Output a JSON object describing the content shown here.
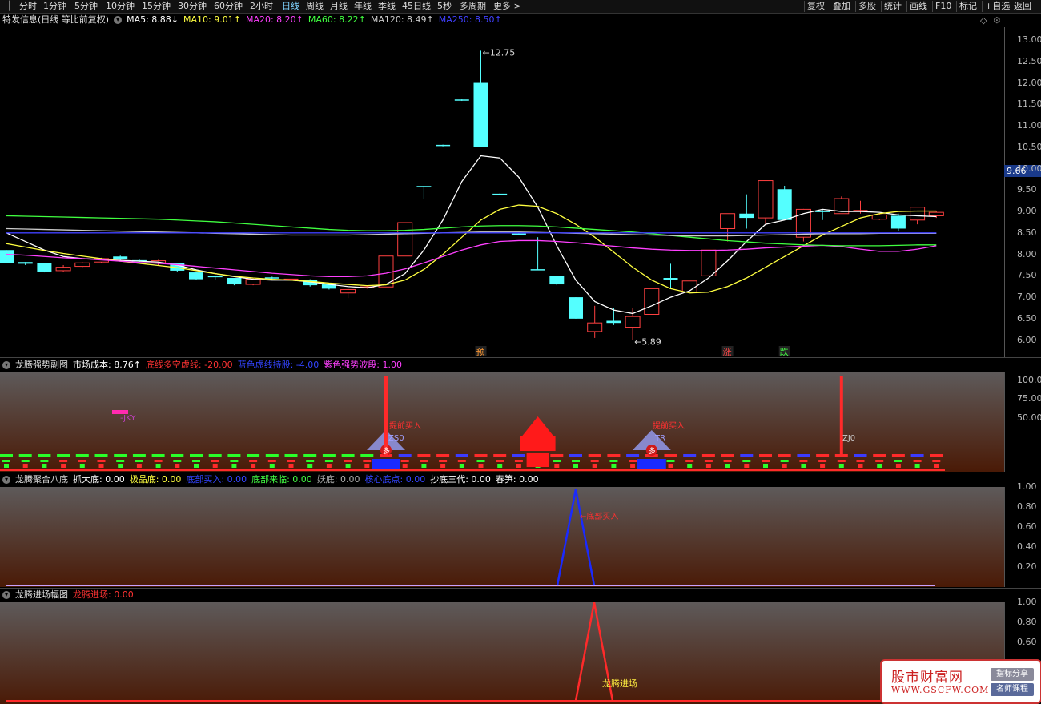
{
  "toolbar": {
    "periods": [
      "分时",
      "1分钟",
      "5分钟",
      "10分钟",
      "15分钟",
      "30分钟",
      "60分钟",
      "2小时",
      "日线",
      "周线",
      "月线",
      "年线",
      "季线",
      "45日线",
      "5秒",
      "多周期",
      "更多 >"
    ],
    "active_period": "日线",
    "right_buttons": [
      "复权",
      "叠加",
      "多股",
      "统计",
      "画线",
      "F10",
      "标记",
      "+自选",
      "返回"
    ]
  },
  "main": {
    "title": "特发信息(日线 等比前复权)",
    "indicators": [
      {
        "label": "MA5: 8.88↓",
        "color": "#ffffff"
      },
      {
        "label": "MA10: 9.01↑",
        "color": "#ffff40"
      },
      {
        "label": "MA20: 8.20↑",
        "color": "#ff40ff"
      },
      {
        "label": "MA60: 8.22↑",
        "color": "#40ff40"
      },
      {
        "label": "MA120: 8.49↑",
        "color": "#cccccc"
      },
      {
        "label": "MA250: 8.50↑",
        "color": "#4040ff"
      }
    ],
    "price_ticks": [
      "13.00",
      "12.50",
      "12.00",
      "11.50",
      "11.00",
      "10.50",
      "10.00",
      "9.50",
      "9.00",
      "8.50",
      "8.00",
      "7.50",
      "7.00",
      "6.50",
      "6.00"
    ],
    "current_price": "9.66",
    "high_label": "12.75",
    "low_label": "5.89",
    "markers": [
      {
        "text": "预",
        "color": "#ff9933"
      },
      {
        "text": "涨",
        "color": "#ff4444"
      },
      {
        "text": "跌",
        "color": "#44ff44"
      }
    ]
  },
  "chart_data": {
    "type": "candlestick",
    "candles": [
      {
        "o": 8.1,
        "c": 7.8,
        "h": 8.1,
        "l": 7.8
      },
      {
        "o": 7.82,
        "c": 7.78,
        "h": 7.82,
        "l": 7.75
      },
      {
        "o": 7.8,
        "c": 7.6,
        "h": 7.8,
        "l": 7.58
      },
      {
        "o": 7.62,
        "c": 7.7,
        "h": 7.75,
        "l": 7.6
      },
      {
        "o": 7.72,
        "c": 7.8,
        "h": 7.82,
        "l": 7.7
      },
      {
        "o": 7.82,
        "c": 7.9,
        "h": 7.92,
        "l": 7.8
      },
      {
        "o": 7.95,
        "c": 7.88,
        "h": 7.97,
        "l": 7.85
      },
      {
        "o": 7.85,
        "c": 7.82,
        "h": 7.88,
        "l": 7.78
      },
      {
        "o": 7.8,
        "c": 7.85,
        "h": 7.87,
        "l": 7.75
      },
      {
        "o": 7.8,
        "c": 7.62,
        "h": 7.8,
        "l": 7.6
      },
      {
        "o": 7.58,
        "c": 7.42,
        "h": 7.6,
        "l": 7.4
      },
      {
        "o": 7.48,
        "c": 7.48,
        "h": 7.5,
        "l": 7.4
      },
      {
        "o": 7.45,
        "c": 7.3,
        "h": 7.45,
        "l": 7.28
      },
      {
        "o": 7.3,
        "c": 7.42,
        "h": 7.45,
        "l": 7.28
      },
      {
        "o": 7.45,
        "c": 7.45,
        "h": 7.48,
        "l": 7.42
      },
      {
        "o": 7.4,
        "c": 7.42,
        "h": 7.44,
        "l": 7.38
      },
      {
        "o": 7.4,
        "c": 7.28,
        "h": 7.42,
        "l": 7.25
      },
      {
        "o": 7.3,
        "c": 7.2,
        "h": 7.3,
        "l": 7.18
      },
      {
        "o": 7.1,
        "c": 7.18,
        "h": 7.2,
        "l": 6.98
      },
      {
        "o": 7.22,
        "c": 7.24,
        "h": 7.26,
        "l": 7.2
      },
      {
        "o": 7.24,
        "c": 7.96,
        "h": 7.96,
        "l": 7.24
      },
      {
        "o": 7.96,
        "c": 8.74,
        "h": 8.74,
        "l": 7.96
      },
      {
        "o": 9.58,
        "c": 9.58,
        "h": 9.6,
        "l": 9.3
      },
      {
        "o": 10.54,
        "c": 10.54,
        "h": 10.56,
        "l": 10.52
      },
      {
        "o": 11.6,
        "c": 11.6,
        "h": 11.62,
        "l": 11.58
      },
      {
        "o": 12.0,
        "c": 10.5,
        "h": 12.75,
        "l": 10.5
      },
      {
        "o": 9.4,
        "c": 9.4,
        "h": 9.42,
        "l": 9.38
      },
      {
        "o": 8.47,
        "c": 8.47,
        "h": 8.49,
        "l": 8.45
      },
      {
        "o": 7.64,
        "c": 7.64,
        "h": 8.4,
        "l": 7.64
      },
      {
        "o": 7.5,
        "c": 7.3,
        "h": 7.5,
        "l": 7.28
      },
      {
        "o": 7.0,
        "c": 6.5,
        "h": 7.0,
        "l": 6.5
      },
      {
        "o": 6.2,
        "c": 6.4,
        "h": 6.8,
        "l": 6.05
      },
      {
        "o": 6.45,
        "c": 6.4,
        "h": 6.75,
        "l": 6.35
      },
      {
        "o": 6.3,
        "c": 6.55,
        "h": 6.75,
        "l": 6.0
      },
      {
        "o": 6.6,
        "c": 7.2,
        "h": 7.2,
        "l": 6.6
      },
      {
        "o": 7.45,
        "c": 7.4,
        "h": 7.78,
        "l": 7.2
      },
      {
        "o": 7.12,
        "c": 7.38,
        "h": 7.38,
        "l": 7.12
      },
      {
        "o": 7.5,
        "c": 8.1,
        "h": 8.1,
        "l": 7.5
      },
      {
        "o": 8.6,
        "c": 8.95,
        "h": 8.95,
        "l": 8.3
      },
      {
        "o": 8.95,
        "c": 8.85,
        "h": 9.4,
        "l": 8.6
      },
      {
        "o": 8.85,
        "c": 9.72,
        "h": 9.72,
        "l": 8.7
      },
      {
        "o": 9.52,
        "c": 8.8,
        "h": 9.6,
        "l": 8.8
      },
      {
        "o": 8.4,
        "c": 9.05,
        "h": 9.06,
        "l": 8.3
      },
      {
        "o": 9.0,
        "c": 9.0,
        "h": 9.05,
        "l": 8.8
      },
      {
        "o": 8.95,
        "c": 9.3,
        "h": 9.35,
        "l": 8.95
      },
      {
        "o": 9.0,
        "c": 9.02,
        "h": 9.25,
        "l": 8.95
      },
      {
        "o": 8.82,
        "c": 8.92,
        "h": 8.95,
        "l": 8.8
      },
      {
        "o": 8.9,
        "c": 8.6,
        "h": 8.95,
        "l": 8.55
      },
      {
        "o": 8.8,
        "c": 9.1,
        "h": 9.1,
        "l": 8.7
      },
      {
        "o": 8.9,
        "c": 8.98,
        "h": 9.02,
        "l": 8.85
      }
    ],
    "ma": [
      {
        "name": "MA5",
        "color": "#ffffff",
        "values": [
          8.5,
          8.3,
          8.1,
          7.95,
          7.9,
          7.88,
          7.86,
          7.84,
          7.82,
          7.75,
          7.64,
          7.55,
          7.48,
          7.42,
          7.4,
          7.4,
          7.36,
          7.3,
          7.25,
          7.22,
          7.3,
          7.55,
          8.1,
          8.8,
          9.7,
          10.3,
          10.25,
          9.8,
          9.1,
          8.2,
          7.4,
          6.9,
          6.7,
          6.62,
          6.8,
          7.0,
          7.15,
          7.45,
          7.85,
          8.3,
          8.7,
          8.8,
          8.95,
          9.05,
          9.0,
          9.0,
          8.98,
          8.92,
          8.9,
          8.88
        ]
      },
      {
        "name": "MA10",
        "color": "#ffff40",
        "values": [
          8.25,
          8.17,
          8.09,
          8.02,
          7.96,
          7.9,
          7.84,
          7.79,
          7.74,
          7.69,
          7.62,
          7.55,
          7.49,
          7.45,
          7.42,
          7.4,
          7.37,
          7.33,
          7.3,
          7.27,
          7.29,
          7.4,
          7.65,
          8.0,
          8.4,
          8.8,
          9.05,
          9.15,
          9.12,
          8.95,
          8.7,
          8.4,
          8.05,
          7.7,
          7.4,
          7.2,
          7.1,
          7.12,
          7.25,
          7.45,
          7.7,
          7.95,
          8.2,
          8.45,
          8.65,
          8.85,
          8.95,
          9.0,
          9.01,
          9.01
        ]
      },
      {
        "name": "MA20",
        "color": "#ff40ff",
        "values": [
          8.0,
          7.98,
          7.95,
          7.92,
          7.9,
          7.87,
          7.84,
          7.81,
          7.79,
          7.76,
          7.72,
          7.68,
          7.64,
          7.6,
          7.56,
          7.53,
          7.5,
          7.48,
          7.48,
          7.5,
          7.56,
          7.66,
          7.8,
          7.95,
          8.1,
          8.22,
          8.3,
          8.32,
          8.32,
          8.3,
          8.27,
          8.23,
          8.19,
          8.15,
          8.12,
          8.1,
          8.09,
          8.09,
          8.1,
          8.12,
          8.15,
          8.17,
          8.19,
          8.21,
          8.18,
          8.12,
          8.07,
          8.07,
          8.12,
          8.2
        ]
      },
      {
        "name": "MA60",
        "color": "#40ff40",
        "values": [
          8.9,
          8.89,
          8.88,
          8.87,
          8.86,
          8.85,
          8.84,
          8.83,
          8.82,
          8.8,
          8.78,
          8.76,
          8.73,
          8.7,
          8.67,
          8.64,
          8.61,
          8.58,
          8.56,
          8.55,
          8.55,
          8.56,
          8.58,
          8.61,
          8.64,
          8.66,
          8.67,
          8.67,
          8.66,
          8.64,
          8.61,
          8.58,
          8.55,
          8.52,
          8.48,
          8.44,
          8.4,
          8.36,
          8.32,
          8.29,
          8.26,
          8.24,
          8.22,
          8.21,
          8.2,
          8.2,
          8.2,
          8.21,
          8.22,
          8.22
        ]
      },
      {
        "name": "MA120",
        "color": "#cccccc",
        "values": [
          8.6,
          8.59,
          8.58,
          8.57,
          8.56,
          8.55,
          8.54,
          8.53,
          8.52,
          8.51,
          8.5,
          8.49,
          8.48,
          8.47,
          8.46,
          8.45,
          8.45,
          8.45,
          8.45,
          8.46,
          8.47,
          8.48,
          8.49,
          8.5,
          8.51,
          8.52,
          8.52,
          8.52,
          8.51,
          8.5,
          8.49,
          8.48,
          8.47,
          8.46,
          8.45,
          8.44,
          8.43,
          8.43,
          8.43,
          8.44,
          8.45,
          8.46,
          8.47,
          8.48,
          8.48,
          8.48,
          8.49,
          8.49,
          8.49,
          8.49
        ]
      },
      {
        "name": "MA250",
        "color": "#4040ff",
        "values": [
          8.5,
          8.5,
          8.5,
          8.5,
          8.5,
          8.5,
          8.5,
          8.5,
          8.5,
          8.5,
          8.5,
          8.5,
          8.5,
          8.5,
          8.5,
          8.5,
          8.5,
          8.5,
          8.5,
          8.5,
          8.5,
          8.5,
          8.5,
          8.5,
          8.5,
          8.5,
          8.5,
          8.5,
          8.5,
          8.5,
          8.5,
          8.5,
          8.5,
          8.5,
          8.5,
          8.5,
          8.5,
          8.5,
          8.5,
          8.5,
          8.5,
          8.5,
          8.5,
          8.5,
          8.5,
          8.5,
          8.5,
          8.5,
          8.5,
          8.5
        ]
      }
    ],
    "ylim": [
      5.6,
      13.3
    ]
  },
  "panel1": {
    "title": "龙腾强势副图",
    "fields": [
      {
        "label": "市场成本: 8.76↑",
        "color": "#ffffff"
      },
      {
        "label": "底线多空虚线: -20.00",
        "color": "#ff3333"
      },
      {
        "label": "蓝色虚线持股: -4.00",
        "color": "#3344ff"
      },
      {
        "label": "紫色强势波段: 1.00",
        "color": "#ff40ff"
      }
    ],
    "ticks": [
      "100.0",
      "75.00",
      "50.00"
    ],
    "annotations": [
      "-JKY",
      "提前买入",
      "提前买入",
      "ZS0",
      "TR",
      "ZJ0"
    ],
    "badges": [
      "多",
      "多"
    ]
  },
  "panel2": {
    "title": "龙腾聚合八底",
    "fields": [
      {
        "label": "抓大底: 0.00",
        "color": "#ffffff"
      },
      {
        "label": "极品底: 0.00",
        "color": "#ffff40"
      },
      {
        "label": "底部买入: 0.00",
        "color": "#3344ff"
      },
      {
        "label": "底部来临: 0.00",
        "color": "#44ff44"
      },
      {
        "label": "妖底: 0.00",
        "color": "#aaaaaa"
      },
      {
        "label": "核心底点: 0.00",
        "color": "#3344ff"
      },
      {
        "label": "抄底三代: 0.00",
        "color": "#ffffff"
      },
      {
        "label": "春笋: 0.00",
        "color": "#ffffff"
      }
    ],
    "ticks": [
      "1.00",
      "0.80",
      "0.60",
      "0.40",
      "0.20"
    ],
    "annotation": "底部买入"
  },
  "panel3": {
    "title": "龙腾进场幅图",
    "fields": [
      {
        "label": "龙腾进场: 0.00",
        "color": "#ff3333"
      }
    ],
    "ticks": [
      "1.00",
      "0.80",
      "0.60"
    ],
    "annotation": "龙腾进场"
  },
  "watermark": {
    "title": "股市财富网",
    "url": "WWW.GSCFW.COM",
    "tag1": "指标分享",
    "tag2": "名师课程"
  }
}
